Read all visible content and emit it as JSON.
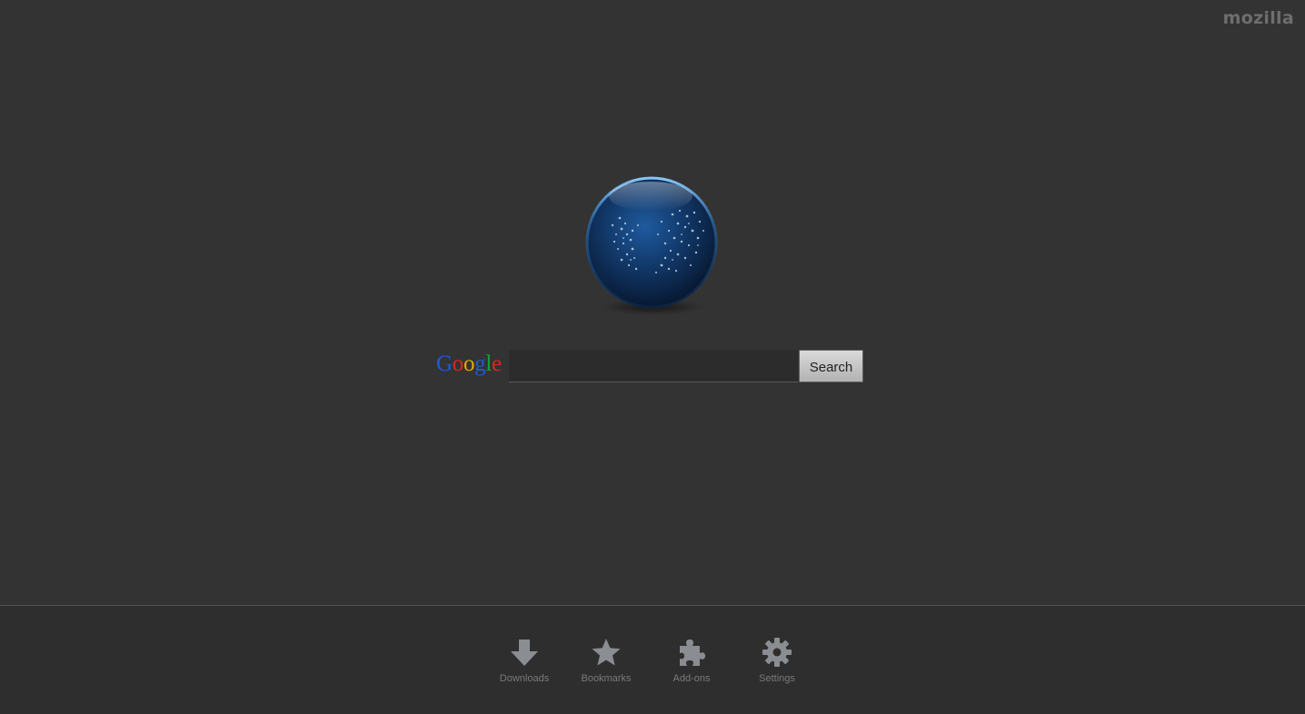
{
  "header": {
    "brand": "mozilla"
  },
  "search": {
    "provider_logo": [
      "G",
      "o",
      "o",
      "g",
      "l",
      "e"
    ],
    "provider_logo_colors": [
      "#1f5bd6",
      "#d52b1e",
      "#e7a800",
      "#1f5bd6",
      "#16a23b",
      "#d52b1e"
    ],
    "input_value": "",
    "input_placeholder": "",
    "button_label": "Search"
  },
  "launchers": [
    {
      "label": "Downloads",
      "icon": "download-arrow-icon"
    },
    {
      "label": "Bookmarks",
      "icon": "star-icon"
    },
    {
      "label": "Add-ons",
      "icon": "puzzle-piece-icon"
    },
    {
      "label": "Settings",
      "icon": "gear-icon"
    }
  ],
  "colors": {
    "background": "#333333",
    "bottom_bar": "#2e2e2e",
    "icon": "#8a8d92",
    "label": "#7a7a7a"
  }
}
